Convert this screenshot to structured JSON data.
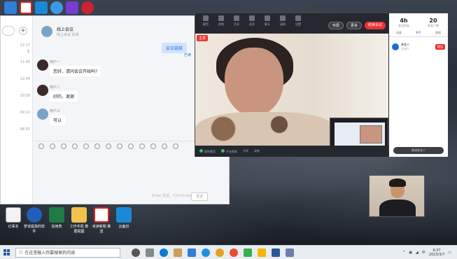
{
  "desktop": {
    "row_labels": [
      "记事本",
      "梦道提我的软件",
      "信用表",
      "工作手机 数据视图",
      "未读新聞 推送",
      "云备份"
    ]
  },
  "chat": {
    "search_placeholder": "",
    "conversations": [
      {
        "time": "12:17",
        "badge": "1"
      },
      {
        "time": "11:40",
        "badge": ""
      },
      {
        "time": "12:04",
        "badge": ""
      },
      {
        "time": "10:30",
        "badge": ""
      },
      {
        "time": "09:12",
        "badge": ""
      },
      {
        "time": "08:55",
        "badge": ""
      }
    ],
    "header_title": "线上会议",
    "header_subtitle": "线上会议 在线",
    "my_message": "会议链接",
    "my_status": "已读",
    "messages": [
      {
        "name": "用户一",
        "text": "您好，请问会议开始吗?"
      },
      {
        "name": "用户二",
        "text": "好的，谢谢"
      },
      {
        "name": "用户三",
        "text": "可以"
      }
    ],
    "input_hint": "Enter 发送，Ctrl+Enter 换行",
    "send_label": "发送"
  },
  "meeting": {
    "title": "会议",
    "toolbar": [
      "静音",
      "视频",
      "共享",
      "成员",
      "聊天",
      "录制",
      "设置"
    ],
    "btn_layout": "布局",
    "btn_more": "更多",
    "btn_end": "结束会议",
    "stats": [
      {
        "value": "4h",
        "label": "会议时长"
      },
      {
        "value": "20",
        "label": "参会人数"
      }
    ],
    "tabs": [
      "全部",
      "举手",
      "其他"
    ],
    "member_name": "参会人",
    "member_sub": "主持人",
    "remove_label": "移出",
    "invite_label": "邀请参会人",
    "video_tag": "主讲",
    "bottom": [
      "解除静音",
      "开启视频",
      "共享",
      "录制"
    ]
  },
  "taskbar": {
    "search_placeholder": "在这里输入你要搜索的内容",
    "time": "9:37",
    "date": "2023/3/7",
    "ime": "中"
  },
  "colors": {
    "accent": "#1f6fd1",
    "danger": "#e33333"
  }
}
